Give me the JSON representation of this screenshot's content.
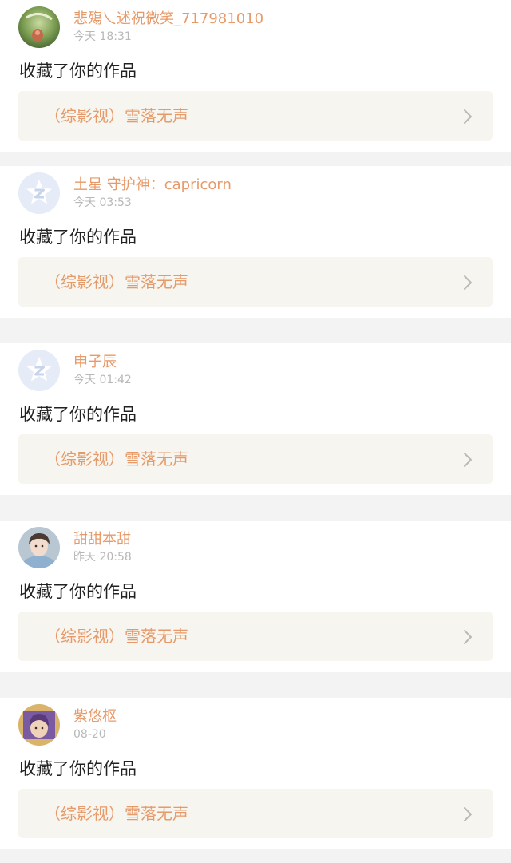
{
  "notifications": [
    {
      "user": "悲殤乀述祝微笑_717981010",
      "time": "今天 18:31",
      "avatar": "photo-avatar-green",
      "action": "收藏了你的作品",
      "work_title": "（综影视）雪落无声",
      "chevron_icon": "chevron-right-icon"
    },
    {
      "user": "土星 守护神：capricorn",
      "time": "今天 03:53",
      "avatar": "default-avatar",
      "action": "收藏了你的作品",
      "work_title": "（综影视）雪落无声",
      "chevron_icon": "chevron-right-icon"
    },
    {
      "user": "申子辰",
      "time": "今天 01:42",
      "avatar": "default-avatar",
      "action": "收藏了你的作品",
      "work_title": "（综影视）雪落无声",
      "chevron_icon": "chevron-right-icon"
    },
    {
      "user": "甜甜本甜",
      "time": "昨天 20:58",
      "avatar": "photo-avatar-person",
      "action": "收藏了你的作品",
      "work_title": "（综影视）雪落无声",
      "chevron_icon": "chevron-right-icon"
    },
    {
      "user": "紫悠枢",
      "time": "08-20",
      "avatar": "photo-avatar-framed",
      "action": "收藏了你的作品",
      "work_title": "（综影视）雪落无声",
      "chevron_icon": "chevron-right-icon"
    }
  ],
  "colors": {
    "accent": "#e79a69",
    "timestamp": "#b8b8b8",
    "text": "#222222",
    "link_bg": "#f6f5ef",
    "separator": "#f3f3f3"
  }
}
